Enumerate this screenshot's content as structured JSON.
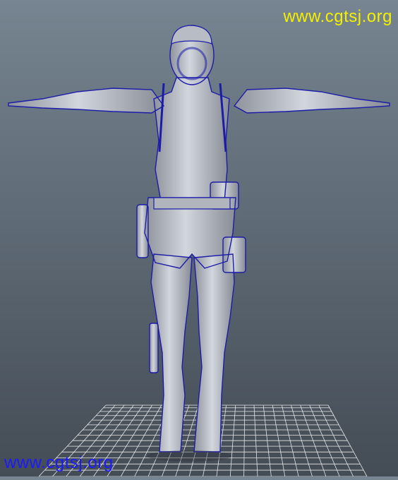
{
  "watermarks": {
    "top": "www.cgtsj.org",
    "bottom": "www.cgtsj.org",
    "top_color": "#f5f000",
    "bottom_color": "#1a1aff"
  },
  "viewport": {
    "background_top": "#768591",
    "background_bottom": "#444c55",
    "mesh_fill": "#bfc4cc",
    "wire_color": "#1c1ca8",
    "grid_color": "#e6e6e6"
  },
  "scene": {
    "object": "character-mesh",
    "pose": "t-pose",
    "display_mode": "wireframe-on-shaded"
  }
}
